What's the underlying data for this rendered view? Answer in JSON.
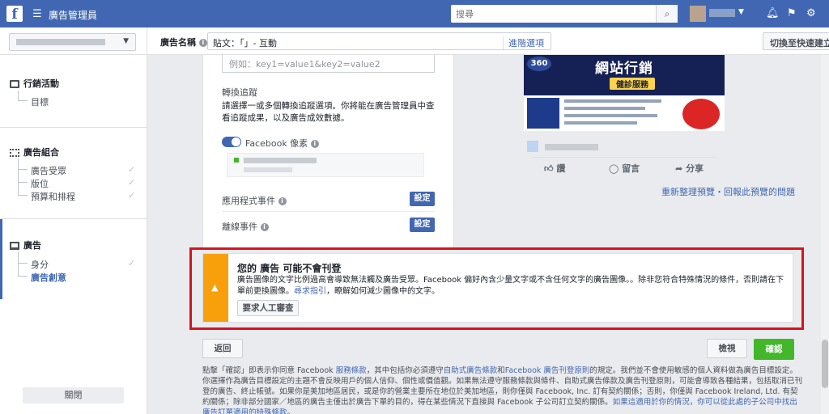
{
  "topbar": {
    "app_title": "廣告管理員",
    "search_placeholder": "搜尋",
    "logo": "f"
  },
  "subbar": {
    "ad_name_label": "廣告名稱",
    "ad_name_value": "貼文：「」- 互動",
    "advanced_options": "進階選項",
    "quick_create": "切換至快速建立流程"
  },
  "sidebar": {
    "campaign": "行銷活動",
    "campaign_items": [
      "目標"
    ],
    "adset": "廣告組合",
    "adset_items": [
      "廣告受眾",
      "版位",
      "預算和排程"
    ],
    "ad": "廣告",
    "ad_items": [
      "身分",
      "廣告創意"
    ],
    "close": "關閉"
  },
  "editor": {
    "url_placeholder": "例如：key1=value1&key2=value2",
    "tracking_heading": "轉換追蹤",
    "tracking_desc": "請選擇一或多個轉換追蹤選項。你將能在廣告管理員中查看追蹤成果，以及廣告成效數據。",
    "pixel_label": "Facebook 像素",
    "app_events": "應用程式事件",
    "offline_events": "離線事件",
    "set_label": "設定"
  },
  "preview": {
    "badge": "360",
    "title": "網站行銷",
    "subtitle": "健診服務",
    "like": "讚",
    "comment": "留言",
    "share": "分享",
    "refresh": "重新整理預覽・回報此預覽的問題"
  },
  "warning": {
    "title": "您的 廣告 可能不會刊登",
    "text_pre": "廣告圖像的文字比例過高會導致無法觸及廣告受眾。Facebook 偏好內含少量文字或不含任何文字的廣告圖像。。除非您符合特殊情況的條件，否則請在下單前更換圖像。",
    "link": "尋求指引",
    "text_post": "，瞭解如何減少圖像中的文字。",
    "review_button": "要求人工審查"
  },
  "footer": {
    "back": "返回",
    "preview": "檢視",
    "confirm": "確認",
    "legal_1": "點擊「確認」即表示你同意 Facebook ",
    "legal_link_1": "服務條款",
    "legal_2": "，其中包括你必須遵守",
    "legal_link_2": "自助式廣告條款",
    "legal_3": "和",
    "legal_link_3": "Facebook 廣告刊登原則",
    "legal_4": "的規定。我們並不會使用敏感的個人資料做為廣告目標設定。你選擇作為廣告目標設定的主題不會反映用戶的個人信仰、個性或價值觀。如果無法遵守服務條款與條件、自助式廣告條款及廣告刊登原則，可能會導致各種結果，包括取消已刊登的廣告、終止帳號。如果你是美加地區居民，或是你的營業主要所在地位於美加地區，則你僅與 Facebook, Inc. 訂有契約關係；否則，你僅與 Facebook Ireland, Ltd. 有契約關係；除非部分國家／地區的廣告主僅出於廣告下單的目的，得在某些情況下直接與 Facebook 子公司訂立契約關係。",
    "legal_link_4": "如果這適用於你的情況，你可以從此處的子公司中找出廣告訂單適用的特殊條款",
    "legal_5": "。"
  }
}
